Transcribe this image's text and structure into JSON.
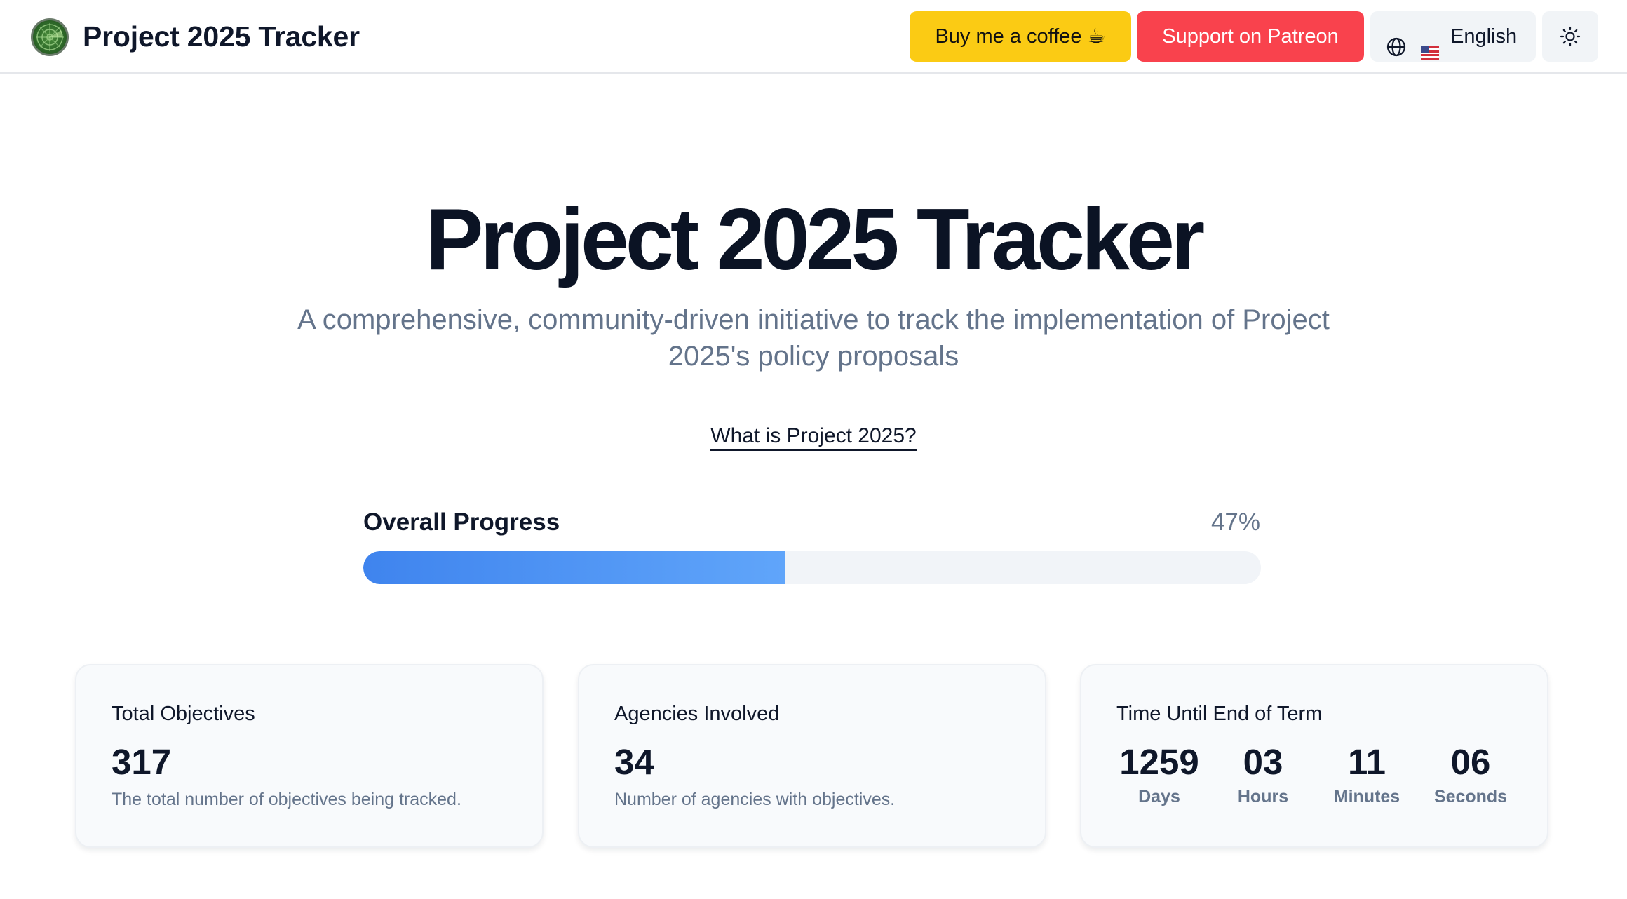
{
  "header": {
    "brand_title": "Project 2025 Tracker",
    "logo_icon": "radar-icon",
    "coffee_label": "Buy me a coffee ☕",
    "patreon_label": "Support on Patreon",
    "language_label": "English",
    "language_flag_icon": "us-flag-icon",
    "globe_icon": "globe-icon",
    "theme_icon": "sun-icon"
  },
  "hero": {
    "title": "Project 2025 Tracker",
    "subtitle": "A comprehensive, community-driven initiative to track the implementation of Project 2025's policy proposals",
    "link_label": "What is Project 2025?"
  },
  "progress": {
    "label": "Overall Progress",
    "percent_text": "47%",
    "value": 0.47
  },
  "cards": {
    "objectives": {
      "title": "Total Objectives",
      "value": "317",
      "description": "The total number of objectives being tracked."
    },
    "agencies": {
      "title": "Agencies Involved",
      "value": "34",
      "description": "Number of agencies with objectives."
    },
    "countdown": {
      "title": "Time Until End of Term",
      "units": [
        {
          "value": "1259",
          "label": "Days"
        },
        {
          "value": "03",
          "label": "Hours"
        },
        {
          "value": "11",
          "label": "Minutes"
        },
        {
          "value": "06",
          "label": "Seconds"
        }
      ]
    }
  },
  "colors": {
    "coffee_button": "#fbcb14",
    "patreon_button": "#f9424d",
    "progress_start": "#3f84ee",
    "progress_end": "#60a5fa"
  }
}
